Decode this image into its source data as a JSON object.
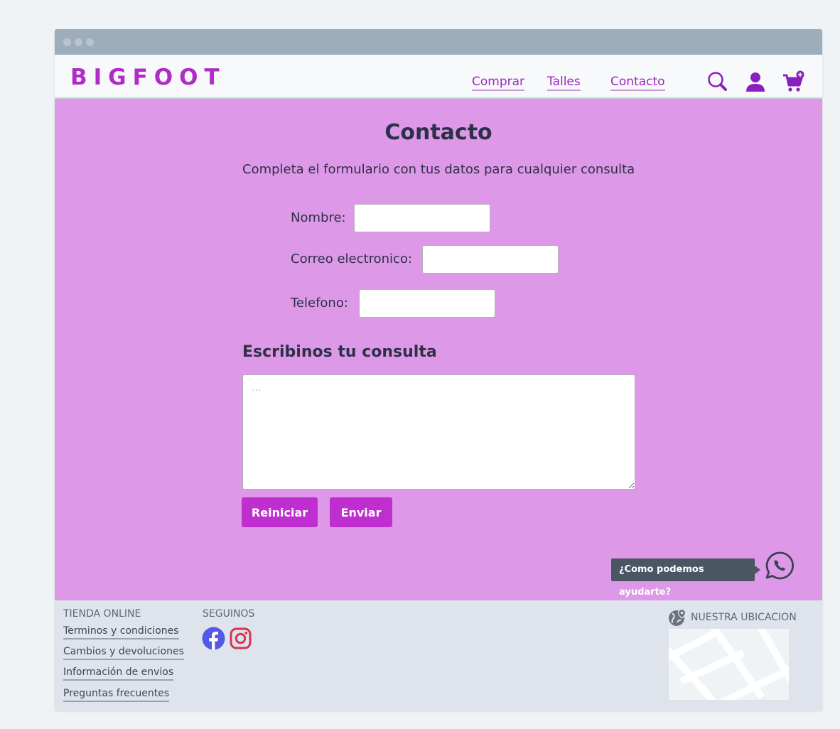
{
  "brand": {
    "name": "BIGFOOT",
    "color": "#b02cc6"
  },
  "nav": {
    "links": [
      "Comprar",
      "Talles",
      "Contacto"
    ],
    "icons": [
      "search-icon",
      "user-icon",
      "cart-add-icon"
    ]
  },
  "main": {
    "title": "Contacto",
    "subtitle": "Completa el formulario con tus datos para cualquier consulta",
    "fields": {
      "name_label": "Nombre:",
      "email_label": "Correo electronico:",
      "phone_label": "Telefono:"
    },
    "consulta_title": "Escribinos tu consulta",
    "consulta_placeholder": "...",
    "reset_label": "Reiniciar",
    "send_label": "Enviar",
    "help_text": "¿Como podemos ayudarte?",
    "background_color": "#dd98e8",
    "button_color": "#bf2ecf"
  },
  "footer": {
    "store_heading": "TIENDA ONLINE",
    "store_links": [
      "Terminos y condiciones",
      "Cambios y devoluciones",
      "Información de envios",
      "Preguntas frecuentes"
    ],
    "follow_heading": "SEGUINOS",
    "social_icons": [
      "facebook-icon",
      "instagram-icon"
    ],
    "location_heading": "NUESTRA UBICACION"
  }
}
